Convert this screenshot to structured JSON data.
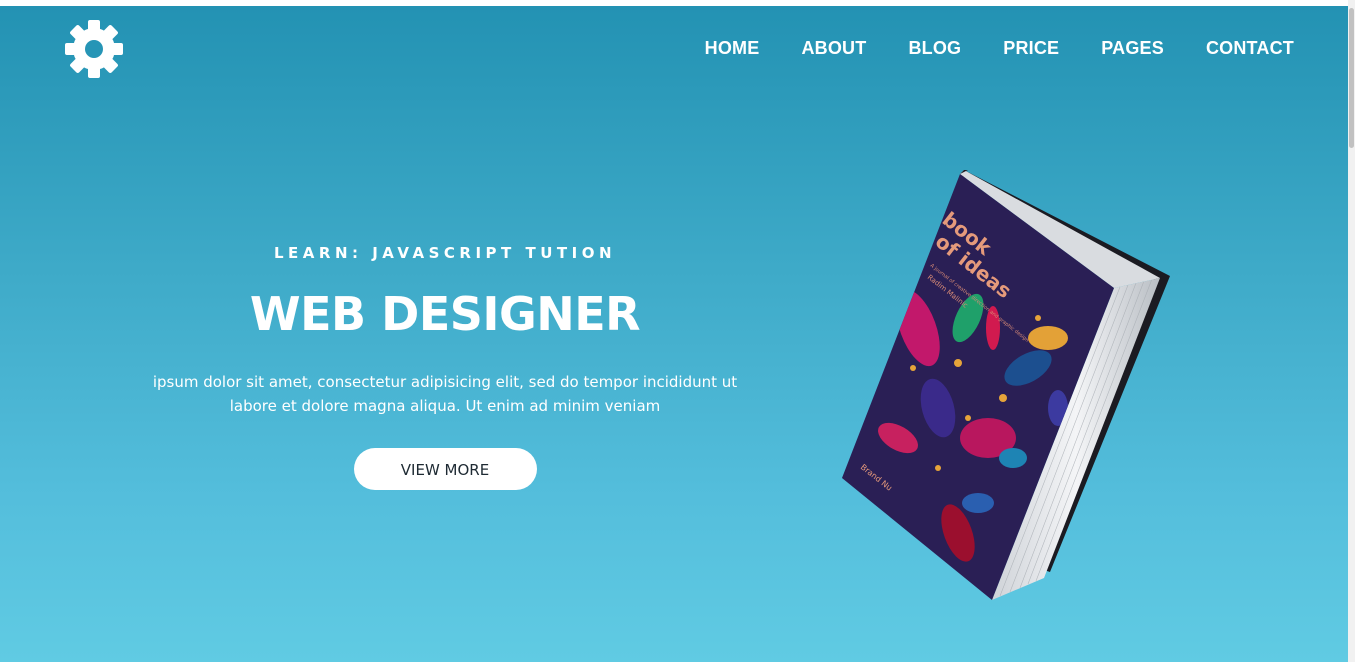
{
  "nav": {
    "items": [
      {
        "label": "HOME"
      },
      {
        "label": "ABOUT"
      },
      {
        "label": "BLOG"
      },
      {
        "label": "PRICE"
      },
      {
        "label": "PAGES"
      },
      {
        "label": "CONTACT"
      }
    ]
  },
  "hero": {
    "eyebrow": "LEARN: JAVASCRIPT TUTION",
    "headline": "WEB DESIGNER",
    "description_line1": "ipsum dolor sit amet, consectetur adipisicing elit, sed do tempor incididunt ut",
    "description_line2": "labore et dolore magna aliqua. Ut enim ad minim veniam",
    "cta_label": "VIEW MORE"
  },
  "book": {
    "title": "book of ideas",
    "subtitle": "A journal of creative direction and graphic design",
    "author": "Radim Malinic",
    "publisher": "Brand Nu"
  },
  "icons": {
    "logo": "gear-icon"
  },
  "colors": {
    "gradient_top": "#2392b3",
    "gradient_bottom": "#60cbe3",
    "text": "#ffffff",
    "button_bg": "#ffffff",
    "button_text": "#1e2a33",
    "book_cover": "#2a1f55"
  }
}
